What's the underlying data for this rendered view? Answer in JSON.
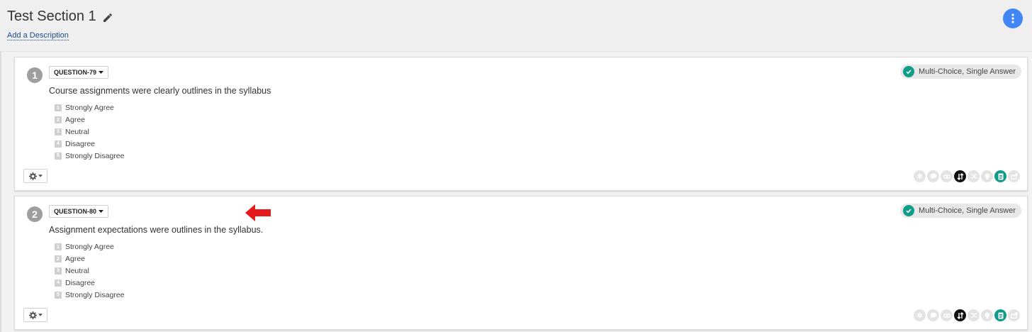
{
  "section": {
    "title": "Test Section 1",
    "add_description": "Add a Description"
  },
  "questions": [
    {
      "number": "1",
      "id_label": "QUESTION-79",
      "text": "Course assignments were clearly outlines in the syllabus",
      "type": "Multi-Choice, Single Answer",
      "answers": [
        {
          "n": "1",
          "label": "Strongly Agree"
        },
        {
          "n": "2",
          "label": "Agree"
        },
        {
          "n": "3",
          "label": "Neutral"
        },
        {
          "n": "4",
          "label": "Disagree"
        },
        {
          "n": "5",
          "label": "Strongly Disagree"
        }
      ]
    },
    {
      "number": "2",
      "id_label": "QUESTION-80",
      "text": "Assignment expectations were outlines in the syllabus.",
      "type": "Multi-Choice, Single Answer",
      "answers": [
        {
          "n": "1",
          "label": "Strongly Agree"
        },
        {
          "n": "2",
          "label": "Agree"
        },
        {
          "n": "3",
          "label": "Neutral"
        },
        {
          "n": "4",
          "label": "Disagree"
        },
        {
          "n": "5",
          "label": "Strongly Disagree"
        }
      ]
    }
  ],
  "option_icons": [
    "asterisk-icon",
    "comment-icon",
    "link-icon",
    "sort-icon",
    "shuffle-icon",
    "lightbulb-icon",
    "document-icon",
    "export-icon"
  ],
  "colors": {
    "accent_blue": "#4285f4",
    "teal": "#0f9d8a",
    "annotation_red": "#e3191c"
  }
}
